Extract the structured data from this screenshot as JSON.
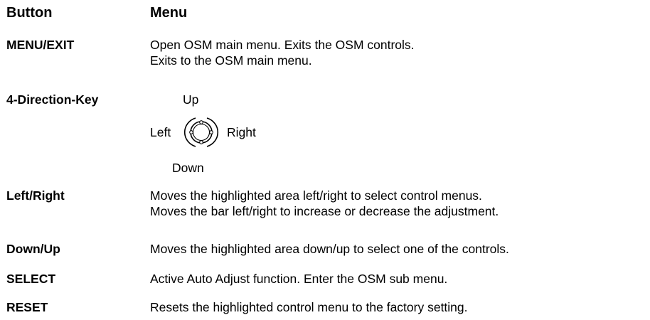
{
  "header": {
    "button_col": "Button",
    "menu_col": "Menu"
  },
  "rows": {
    "menu_exit": {
      "button": "MENU/EXIT",
      "lines": [
        "Open OSM main menu. Exits the OSM controls.",
        "Exits to the OSM main menu."
      ]
    },
    "direction_key": {
      "button": "4-Direction-Key",
      "up": "Up",
      "left": "Left",
      "right": "Right",
      "down": "Down",
      "icon": "four-direction-key-icon"
    },
    "left_right": {
      "button": "Left/Right",
      "lines": [
        "Moves the highlighted area left/right to select control menus.",
        "Moves the bar left/right to increase or decrease the adjustment."
      ]
    },
    "down_up": {
      "button": "Down/Up",
      "lines": [
        "Moves the highlighted area down/up to select one of the controls."
      ]
    },
    "select": {
      "button": "SELECT",
      "lines": [
        "Active Auto Adjust function. Enter the OSM sub menu."
      ]
    },
    "reset": {
      "button": "RESET",
      "lines": [
        "Resets the highlighted control menu to the factory setting."
      ]
    }
  },
  "colors": {
    "text": "#000000",
    "background": "#ffffff"
  }
}
